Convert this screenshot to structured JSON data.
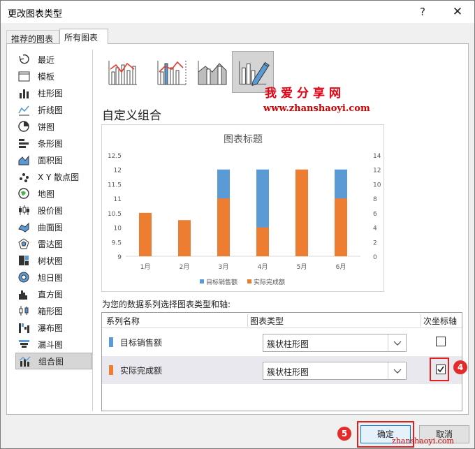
{
  "dialog": {
    "title": "更改图表类型",
    "help_label": "?",
    "close_label": "✕"
  },
  "tabs": [
    {
      "label": "推荐的图表"
    },
    {
      "label": "所有图表"
    }
  ],
  "sidebar": {
    "items": [
      {
        "label": "最近",
        "icon": "recent-icon"
      },
      {
        "label": "模板",
        "icon": "template-icon"
      },
      {
        "label": "柱形图",
        "icon": "column-chart-icon"
      },
      {
        "label": "折线图",
        "icon": "line-chart-icon"
      },
      {
        "label": "饼图",
        "icon": "pie-chart-icon"
      },
      {
        "label": "条形图",
        "icon": "bar-chart-icon"
      },
      {
        "label": "面积图",
        "icon": "area-chart-icon"
      },
      {
        "label": "X Y 散点图",
        "icon": "scatter-chart-icon"
      },
      {
        "label": "地图",
        "icon": "map-chart-icon"
      },
      {
        "label": "股价图",
        "icon": "stock-chart-icon"
      },
      {
        "label": "曲面图",
        "icon": "surface-chart-icon"
      },
      {
        "label": "雷达图",
        "icon": "radar-chart-icon"
      },
      {
        "label": "树状图",
        "icon": "treemap-chart-icon"
      },
      {
        "label": "旭日图",
        "icon": "sunburst-chart-icon"
      },
      {
        "label": "直方图",
        "icon": "histogram-chart-icon"
      },
      {
        "label": "箱形图",
        "icon": "box-whisker-chart-icon"
      },
      {
        "label": "瀑布图",
        "icon": "waterfall-chart-icon"
      },
      {
        "label": "漏斗图",
        "icon": "funnel-chart-icon"
      },
      {
        "label": "组合图",
        "icon": "combo-chart-icon"
      }
    ],
    "selected_index": 18
  },
  "watermark": {
    "cn": "我爱分享网",
    "url": "www.zhanshaoyi.com"
  },
  "section_title": "自定义组合",
  "chart_data": {
    "type": "bar",
    "title": "图表标题",
    "categories": [
      "1月",
      "2月",
      "3月",
      "4月",
      "5月",
      "6月"
    ],
    "series": [
      {
        "name": "目标销售额",
        "axis": "primary",
        "values": [
          0,
          0,
          12,
          12,
          0,
          12
        ],
        "color": "#5b9bd5"
      },
      {
        "name": "实际完成额",
        "axis": "secondary",
        "values": [
          6,
          5,
          8,
          4,
          12,
          8
        ],
        "color": "#ed7d31"
      }
    ],
    "y_primary": {
      "min": 9,
      "max": 12.5,
      "ticks": [
        "12.5",
        "12",
        "11.5",
        "11",
        "10.5",
        "10",
        "9.5",
        "9"
      ]
    },
    "y_secondary": {
      "min": 0,
      "max": 14,
      "ticks": [
        "14",
        "12",
        "10",
        "8",
        "6",
        "4",
        "2",
        "0"
      ]
    },
    "legend": "bottom",
    "grid": false
  },
  "series_prompt": "为您的数据系列选择图表类型和轴:",
  "table": {
    "headers": {
      "name": "系列名称",
      "type": "图表类型",
      "secondary": "次坐标轴"
    },
    "rows": [
      {
        "name": "目标销售额",
        "color": "#5b9bd5",
        "chart_type": "簇状柱形图",
        "secondary_axis": false
      },
      {
        "name": "实际完成额",
        "color": "#ed7d31",
        "chart_type": "簇状柱形图",
        "secondary_axis": true
      }
    ]
  },
  "badges": {
    "step4": "4",
    "step5": "5"
  },
  "buttons": {
    "ok": "确定",
    "cancel": "取消"
  },
  "footer_url": "zhanshaoyi.com"
}
